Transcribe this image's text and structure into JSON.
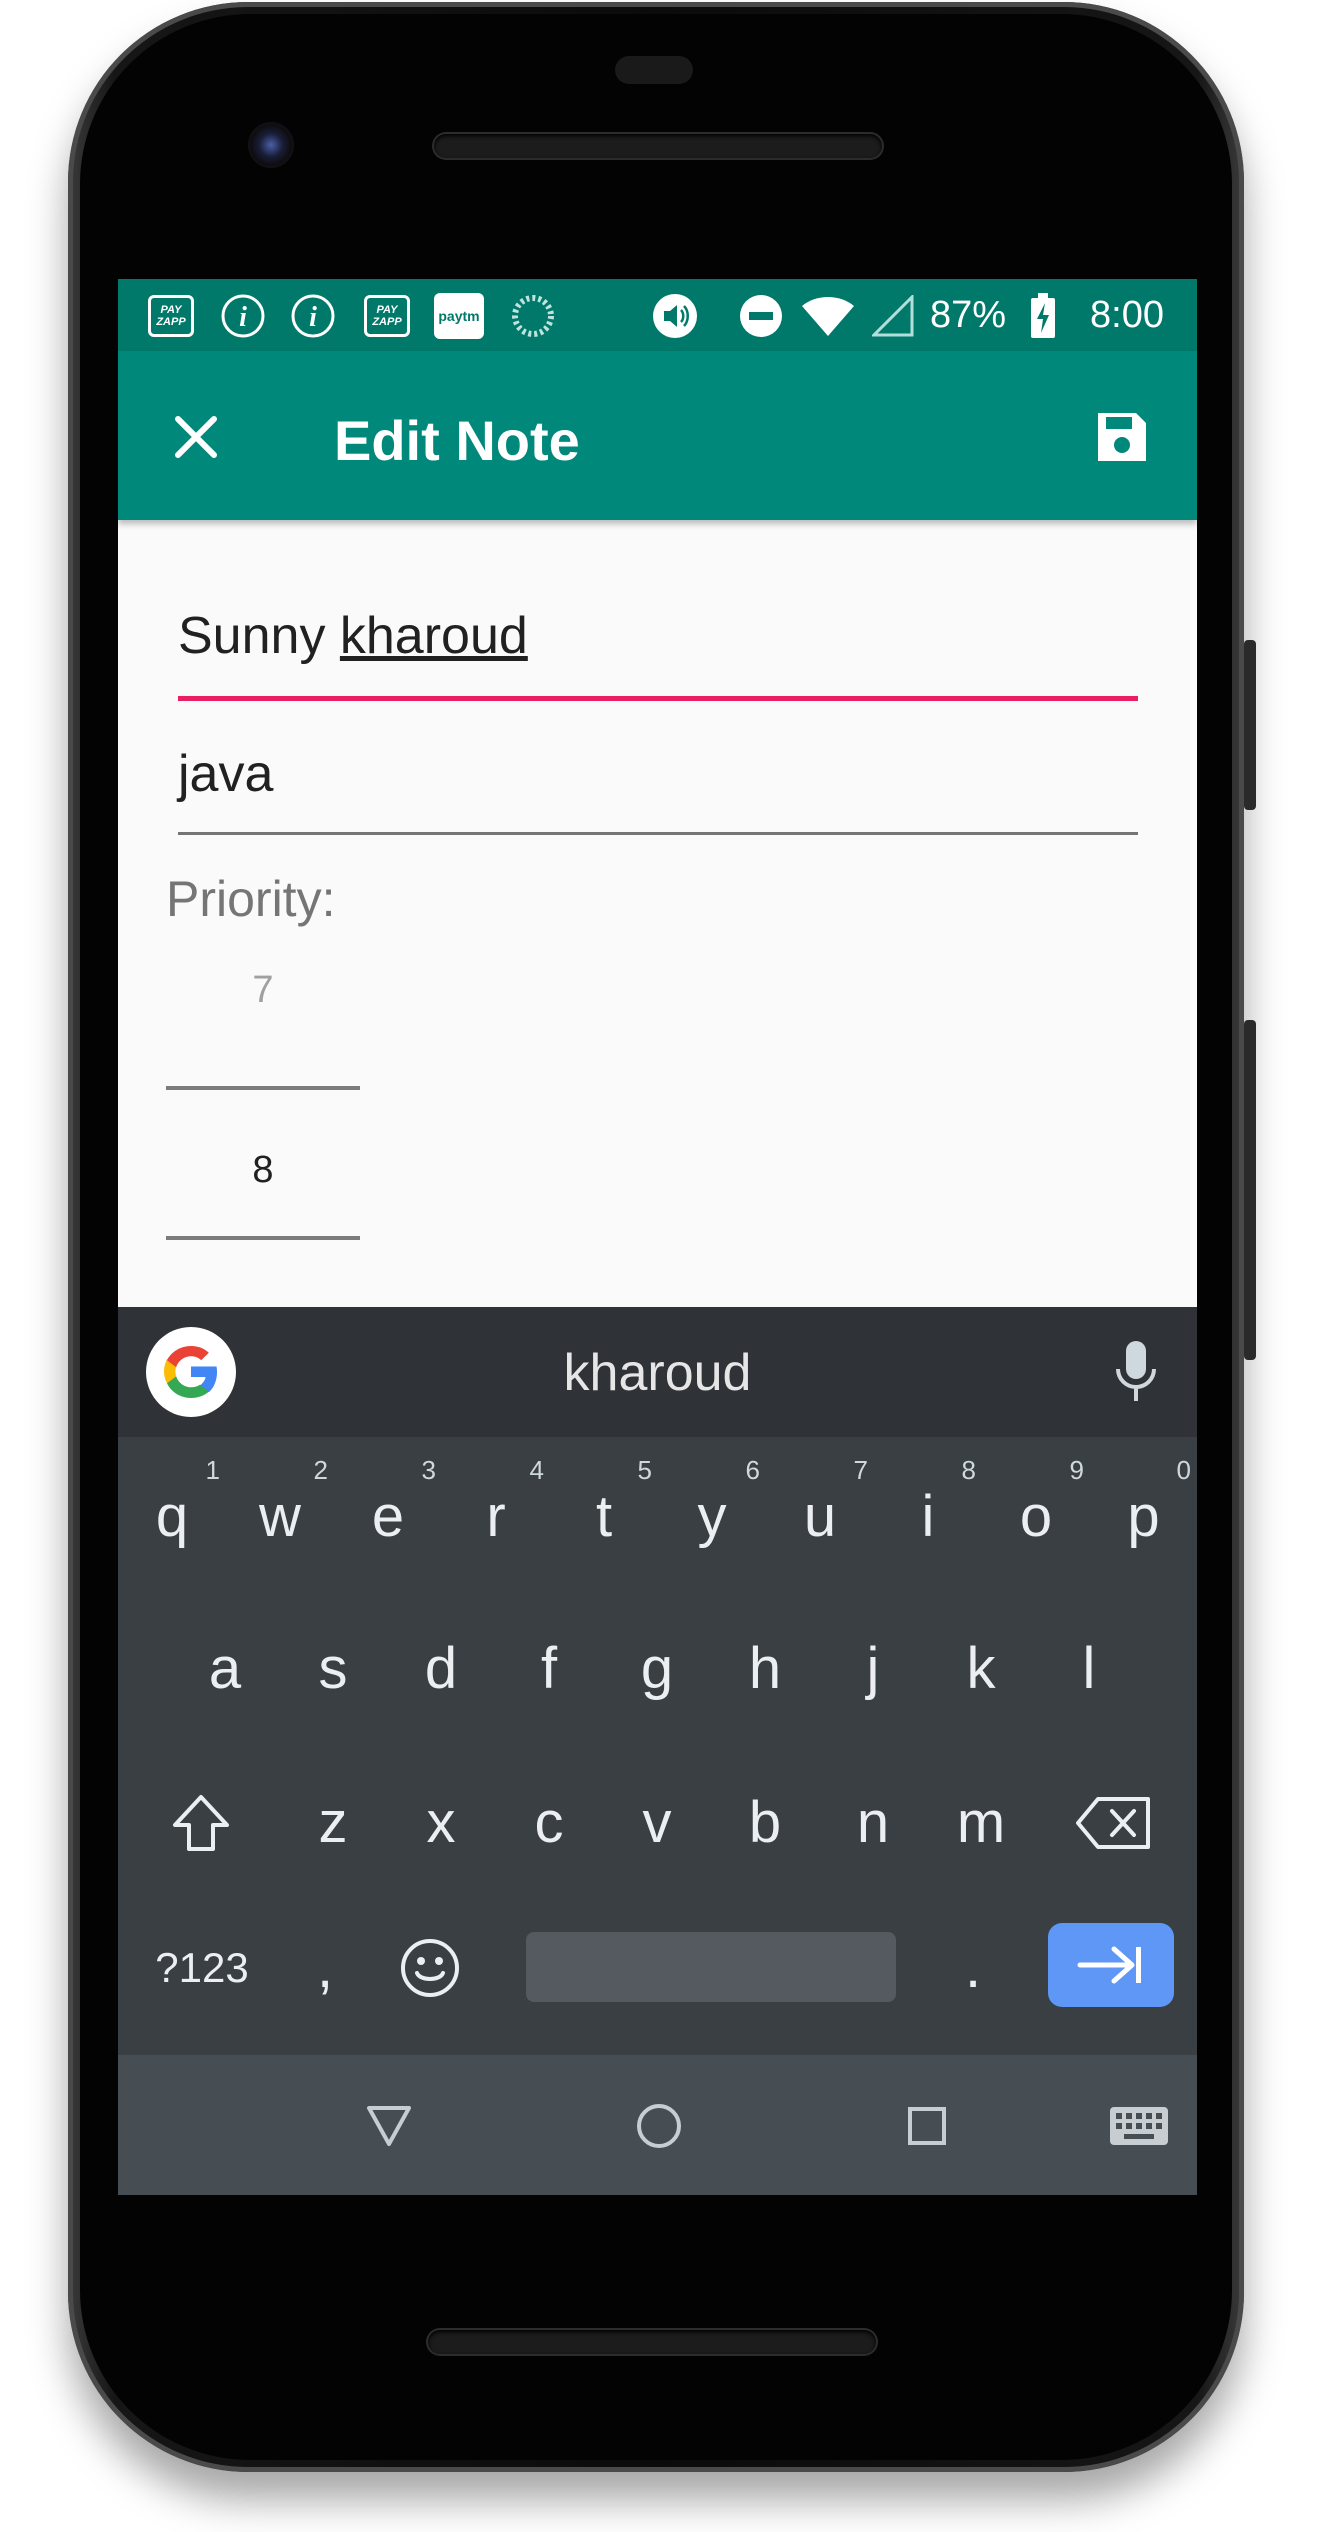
{
  "status_bar": {
    "notification_icons": [
      "payzapp-icon",
      "imobile-icon",
      "imobile-icon",
      "payzapp-icon",
      "paytm-icon",
      "loading-circle-icon"
    ],
    "payzapp_label": "PAY ZAPP",
    "paytm_label": "paytm",
    "battery": "87%",
    "time": "8:00"
  },
  "app_bar": {
    "title": "Edit Note",
    "close_icon": "close-icon",
    "save_icon": "save-icon"
  },
  "form": {
    "title_value_plain": "Sunny ",
    "title_value_underlined": "kharoud",
    "description_value": "java",
    "priority_label": "Priority:",
    "priority_prev": "7",
    "priority_current": "8"
  },
  "keyboard": {
    "suggestion": "kharoud",
    "row1": [
      "q",
      "w",
      "e",
      "r",
      "t",
      "y",
      "u",
      "i",
      "o",
      "p"
    ],
    "row1_hints": [
      "1",
      "2",
      "3",
      "4",
      "5",
      "6",
      "7",
      "8",
      "9",
      "0"
    ],
    "row2": [
      "a",
      "s",
      "d",
      "f",
      "g",
      "h",
      "j",
      "k",
      "l"
    ],
    "row3": [
      "z",
      "x",
      "c",
      "v",
      "b",
      "n",
      "m"
    ],
    "symbols_label": "?123",
    "comma": ",",
    "period": ".",
    "accent_color": "#5e97f6"
  },
  "colors": {
    "app_bar": "#00897b",
    "status_bar": "#00796b",
    "title_underline": "#e91e63"
  }
}
